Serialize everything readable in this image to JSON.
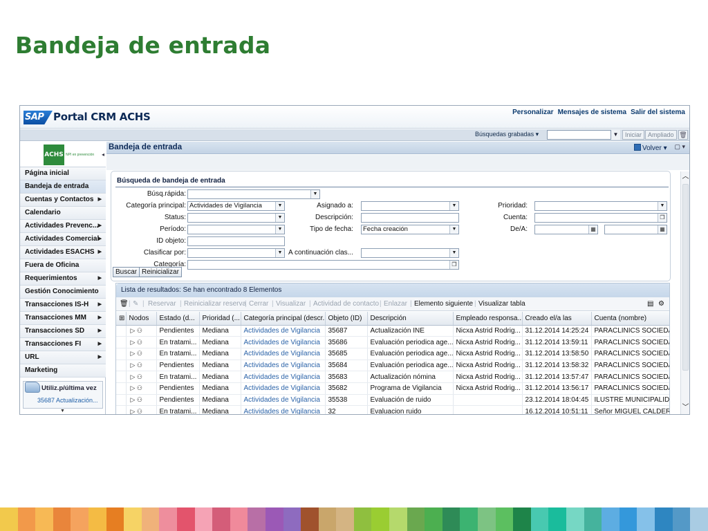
{
  "slide": {
    "title": "Bandeja de entrada"
  },
  "portal": {
    "logo_text": "SAP",
    "title": "Portal CRM ACHS",
    "header_links": [
      "Personalizar",
      "Mensajes de sistema",
      "Salir del sistema"
    ]
  },
  "toolbar": {
    "saved_searches": "Búsquedas grabadas",
    "iniciar": "Iniciar",
    "ampliado": "Ampliado"
  },
  "nav": {
    "logo_text": "ACHS",
    "logo_sub": "NPI en prevención",
    "items": [
      {
        "label": "Página inicial",
        "arrow": false
      },
      {
        "label": "Bandeja de entrada",
        "arrow": false
      },
      {
        "label": "Cuentas y Contactos",
        "arrow": true
      },
      {
        "label": "Calendario",
        "arrow": false
      },
      {
        "label": "Actividades Prevenc...",
        "arrow": true
      },
      {
        "label": "Actividades Comercial",
        "arrow": true
      },
      {
        "label": "Actividades ESACHS",
        "arrow": true
      },
      {
        "label": "Fuera de Oficina",
        "arrow": false
      },
      {
        "label": "Requerimientos",
        "arrow": true
      },
      {
        "label": "Gestión Conocimiento",
        "arrow": false
      },
      {
        "label": "Transacciones IS-H",
        "arrow": true
      },
      {
        "label": "Transacciones MM",
        "arrow": true
      },
      {
        "label": "Transacciones SD",
        "arrow": true
      },
      {
        "label": "Transacciones FI",
        "arrow": true
      },
      {
        "label": "URL",
        "arrow": true
      },
      {
        "label": "Marketing",
        "arrow": false
      }
    ],
    "recent_title": "Utiliz.p/última vez",
    "recent_link": "35687 Actualización..."
  },
  "content": {
    "title": "Bandeja de entrada",
    "volver": "Volver"
  },
  "search": {
    "title": "Búsqueda de bandeja de entrada",
    "labels": {
      "busq_rapida": "Búsq.rápida:",
      "categoria_principal": "Categoría principal:",
      "status": "Status:",
      "periodo": "Período:",
      "id_objeto": "ID objeto:",
      "clasificar_por": "Clasificar por:",
      "categoria": "Categoría:",
      "asignado_a": "Asignado a:",
      "descripcion": "Descripción:",
      "tipo_fecha": "Tipo de fecha:",
      "a_continuacion": "A continuación clas...",
      "prioridad": "Prioridad:",
      "cuenta": "Cuenta:",
      "de_a": "De/A:"
    },
    "values": {
      "categoria_principal": "Actividades de Vigilancia",
      "tipo_fecha": "Fecha creación"
    },
    "buttons": {
      "buscar": "Buscar",
      "reinicializar": "Reinicializar"
    }
  },
  "results": {
    "header": "Lista de resultados: Se han encontrado 8 Elementos",
    "toolbar": [
      {
        "label": "Reservar",
        "enabled": false
      },
      {
        "label": "Reinicializar reserva",
        "enabled": false
      },
      {
        "label": "Cerrar",
        "enabled": false
      },
      {
        "label": "Visualizar",
        "enabled": false
      },
      {
        "label": "Actividad de contacto",
        "enabled": false
      },
      {
        "label": "Enlazar",
        "enabled": false
      },
      {
        "label": "Elemento siguiente",
        "enabled": true
      },
      {
        "label": "Visualizar tabla",
        "enabled": true
      }
    ],
    "columns": [
      "Nodos",
      "Estado (d...",
      "Prioridad (...",
      "Categoría principal (descr...",
      "Objeto (ID)",
      "Descripción",
      "Empleado responsa...",
      "Creado el/a las",
      "Cuenta (nombre)"
    ],
    "rows": [
      [
        "Pendientes",
        "Mediana",
        "Actividades de Vigilancia",
        "35687",
        "Actualización INE",
        "Nicxa Astrid Rodrig...",
        "31.12.2014 14:25:24",
        "PARACLINICS SOCIEDAD"
      ],
      [
        "En tratami...",
        "Mediana",
        "Actividades de Vigilancia",
        "35686",
        "Evaluación periodica age...",
        "Nicxa Astrid Rodrig...",
        "31.12.2014 13:59:11",
        "PARACLINICS SOCIEDAD"
      ],
      [
        "En tratami...",
        "Mediana",
        "Actividades de Vigilancia",
        "35685",
        "Evaluación periodica age...",
        "Nicxa Astrid Rodrig...",
        "31.12.2014 13:58:50",
        "PARACLINICS SOCIEDAD"
      ],
      [
        "Pendientes",
        "Mediana",
        "Actividades de Vigilancia",
        "35684",
        "Evaluación periodica age...",
        "Nicxa Astrid Rodrig...",
        "31.12.2014 13:58:32",
        "PARACLINICS SOCIEDAD"
      ],
      [
        "En tratami...",
        "Mediana",
        "Actividades de Vigilancia",
        "35683",
        "Actualización nómina",
        "Nicxa Astrid Rodrig...",
        "31.12.2014 13:57:47",
        "PARACLINICS SOCIEDAD"
      ],
      [
        "Pendientes",
        "Mediana",
        "Actividades de Vigilancia",
        "35682",
        "Programa de Vigilancia",
        "Nicxa Astrid Rodrig...",
        "31.12.2014 13:56:17",
        "PARACLINICS SOCIEDAD"
      ],
      [
        "Pendientes",
        "Mediana",
        "Actividades de Vigilancia",
        "35538",
        "Evaluación de ruido",
        "",
        "23.12.2014 18:04:45",
        "ILUSTRE MUNICIPALIDAD"
      ],
      [
        "En tratami...",
        "Mediana",
        "Actividades de Vigilancia",
        "32",
        "Evaluacion ruido",
        "",
        "16.12.2014 10:51:11",
        "Señor MIGUEL CALDERO"
      ]
    ]
  },
  "colors": {
    "title_green": "#2e7d32",
    "link_blue": "#2b63a8",
    "stripe": [
      "#f2c94c",
      "#f2994a",
      "#f7b955",
      "#e9853b",
      "#f5a35e",
      "#f4bb44",
      "#e67e22",
      "#f6d365",
      "#f0b27a",
      "#ee8e9d",
      "#e3546c",
      "#f5a3b5",
      "#d45d79",
      "#f08a9b",
      "#b86fa6",
      "#9b59b6",
      "#8e6bbf",
      "#a0522d",
      "#c9a66b",
      "#d4b483",
      "#8fbf3f",
      "#9acd32",
      "#b5d96c",
      "#6aa84f",
      "#4caf50",
      "#2e8b57",
      "#3cb371",
      "#7dc383",
      "#5cbf60",
      "#1e8449",
      "#48c9b0",
      "#1abc9c",
      "#76d7c4",
      "#45b39d",
      "#5dade2",
      "#3498db",
      "#85c1e9",
      "#2e86c1",
      "#5499c7",
      "#a9cce3"
    ]
  }
}
